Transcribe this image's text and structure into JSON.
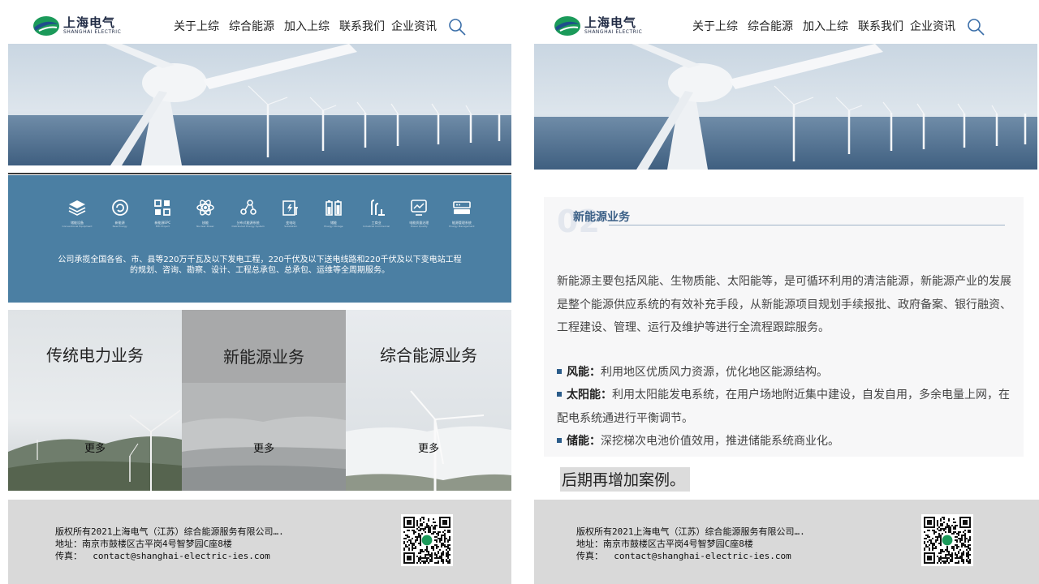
{
  "logo": {
    "cn": "上海电气",
    "en": "SHANGHAI ELECTRIC"
  },
  "nav": [
    "关于上综",
    "综合能源",
    "加入上综",
    "联系我们",
    "企业资讯"
  ],
  "services": {
    "icons": [
      {
        "label": "储能设备",
        "sub": "Conventional Equipment",
        "icon": "layers-icon"
      },
      {
        "label": "新能源",
        "sub": "New Energy",
        "icon": "recycle-icon"
      },
      {
        "label": "新能源EPC",
        "sub": "EPC Project",
        "icon": "grid-blocks-icon"
      },
      {
        "label": "核能",
        "sub": "Nuclear Power",
        "icon": "atom-icon"
      },
      {
        "label": "分布式能源系统",
        "sub": "Distributed Energy System",
        "icon": "network-icon"
      },
      {
        "label": "变电站",
        "sub": "Substation",
        "icon": "substation-icon"
      },
      {
        "label": "储能",
        "sub": "Energy Storage",
        "icon": "battery-icon"
      },
      {
        "label": "工商业",
        "sub": "Industrial Commercial",
        "icon": "factory-icon"
      },
      {
        "label": "电能质量治理",
        "sub": "Power Quality",
        "icon": "monitor-icon"
      },
      {
        "label": "能源管理系统",
        "sub": "Energy Management",
        "icon": "router-icon"
      }
    ],
    "description": "公司承揽全国各省、市、县等220万千瓦及以下发电工程，220千伏及以下送电线路和220千伏及以下变电站工程的规划、咨询、勘察、设计、工程总承包、总承包、运维等全周期服务。"
  },
  "columns": [
    {
      "title": "传统电力业务",
      "more": "更多"
    },
    {
      "title": "新能源业务",
      "more": "更多"
    },
    {
      "title": "综合能源业务",
      "more": "更多"
    }
  ],
  "footer": {
    "copyright": "版权所有2021上海电气（江苏）综合能源服务有限公司….",
    "address": "地址：南京市鼓楼区古平岗4号智梦园C座8楼",
    "fax_label": "传真：",
    "fax_value": "contact@shanghai-electric-ies.com"
  },
  "article": {
    "number": "02",
    "title": "新能源业务",
    "paragraph": "新能源主要包括风能、生物质能、太阳能等，是可循环利用的清洁能源，新能源产业的发展是整个能源供应系统的有效补充手段，从新能源项目规划手续报批、政府备案、银行融资、工程建设、管理、运行及维护等进行全流程跟踪服务。",
    "bullets": [
      {
        "label": "风能：",
        "text": "利用地区优质风力资源，优化地区能源结构。"
      },
      {
        "label": "太阳能：",
        "text": "利用太阳能发电系统，在用户场地附近集中建设，自发自用，多余电量上网，在配电系统通进行平衡调节。"
      },
      {
        "label": "储能：",
        "text": "深挖梯次电池价值效用，推进储能系统商业化。"
      }
    ]
  },
  "note": "后期再增加案例。",
  "colors": {
    "band": "#4b7fa3",
    "footer": "#d9d9d9",
    "accent": "#2b5c8a",
    "brand_green": "#1b9a5a",
    "brand_blue": "#1f4e8c"
  }
}
